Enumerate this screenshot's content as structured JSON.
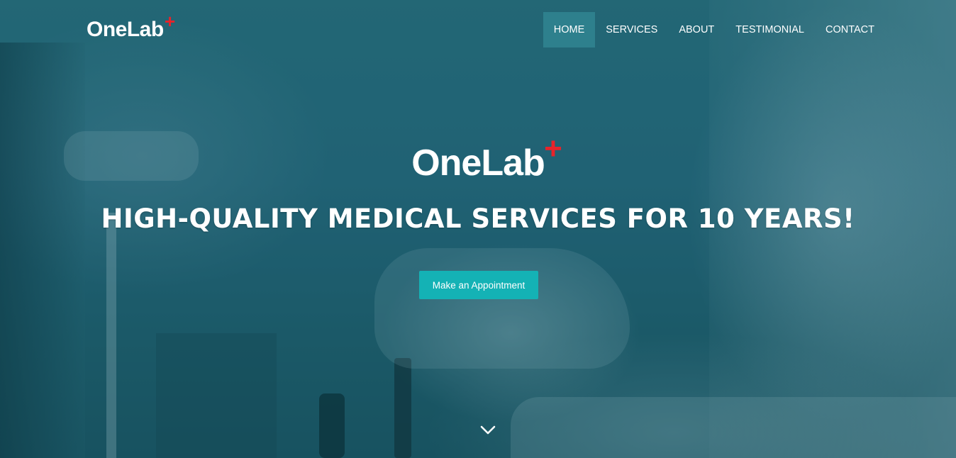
{
  "brand": {
    "name": "OneLab",
    "plus_symbol": "+",
    "plus_color": "#e8232a"
  },
  "nav": {
    "items": [
      {
        "label": "HOME",
        "active": true
      },
      {
        "label": "SERVICES",
        "active": false
      },
      {
        "label": "ABOUT",
        "active": false
      },
      {
        "label": "TESTIMONIAL",
        "active": false
      },
      {
        "label": "CONTACT",
        "active": false
      }
    ],
    "active_bg": "#3996a0"
  },
  "hero": {
    "logo_text": "OneLab",
    "logo_plus": "+",
    "headline": "HIGH-QUALITY MEDICAL SERVICES FOR 10 YEARS!",
    "cta_label": "Make an Appointment",
    "cta_color": "#14b2b5",
    "scroll_icon": "chevron-down-icon",
    "overlay_color": "#1f5a66"
  }
}
